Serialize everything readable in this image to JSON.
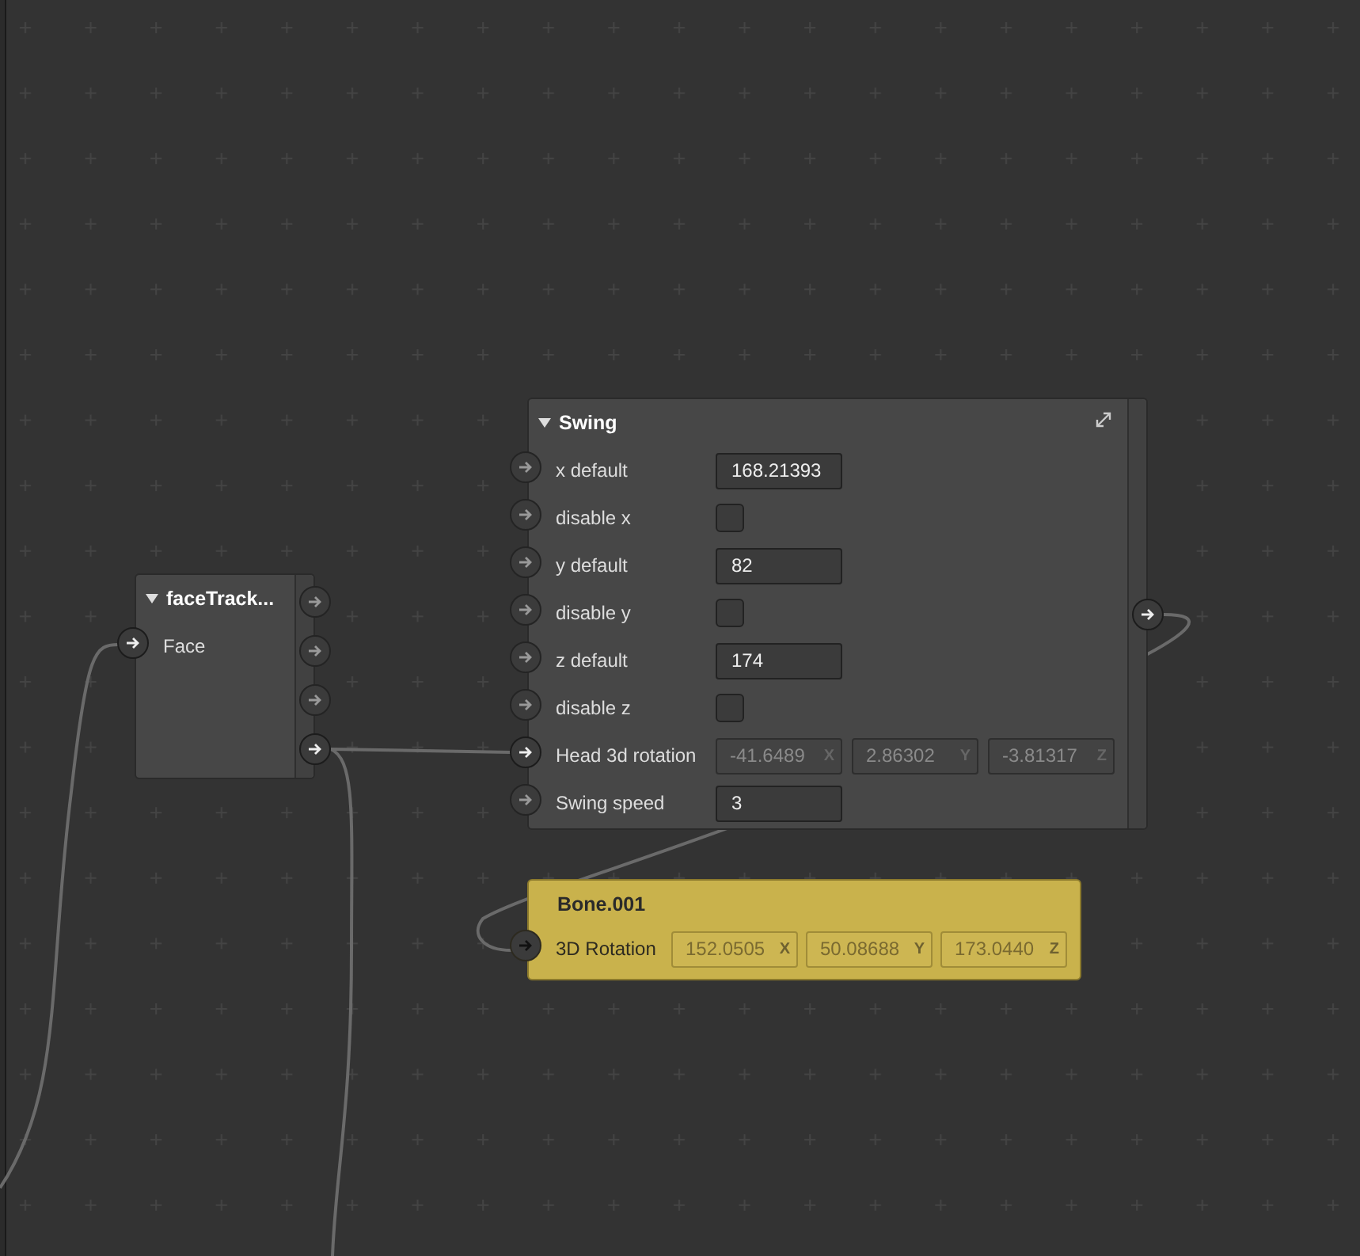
{
  "nodes": [
    {
      "title": "faceTrack...",
      "expanded": true,
      "selected": false,
      "rows": [
        {
          "kind": "socket",
          "label": "Face",
          "connected": true
        }
      ],
      "outputs": [
        {
          "connected": false
        },
        {
          "connected": false
        },
        {
          "connected": false
        },
        {
          "connected": true
        }
      ]
    },
    {
      "title": "Swing",
      "expanded": true,
      "selected": false,
      "maximize": true,
      "rows": [
        {
          "kind": "number",
          "label": "x default",
          "value": "168.21393",
          "connected": false
        },
        {
          "kind": "checkbox",
          "label": "disable x",
          "checked": false,
          "connected": false
        },
        {
          "kind": "number",
          "label": "y default",
          "value": "82",
          "connected": false
        },
        {
          "kind": "checkbox",
          "label": "disable y",
          "checked": false,
          "connected": false
        },
        {
          "kind": "number",
          "label": "z default",
          "value": "174",
          "connected": false
        },
        {
          "kind": "checkbox",
          "label": "disable z",
          "checked": false,
          "connected": false
        },
        {
          "kind": "vector",
          "label": "Head 3d rotation",
          "disabled": true,
          "connected": true,
          "components": [
            {
              "value": "-41.6489",
              "axis": "X"
            },
            {
              "value": "2.86302",
              "axis": "Y"
            },
            {
              "value": "-3.81317",
              "axis": "Z"
            }
          ]
        },
        {
          "kind": "number",
          "label": "Swing speed",
          "value": "3",
          "connected": false
        }
      ],
      "outputs": [
        {
          "connected": true
        }
      ]
    },
    {
      "title": "Bone.001",
      "expanded": false,
      "selected": true,
      "rows": [
        {
          "kind": "vector",
          "label": "3D Rotation",
          "connected": true,
          "components": [
            {
              "value": "152.0505",
              "axis": "X"
            },
            {
              "value": "50.08688",
              "axis": "Y"
            },
            {
              "value": "173.0440",
              "axis": "Z"
            }
          ]
        }
      ]
    }
  ]
}
